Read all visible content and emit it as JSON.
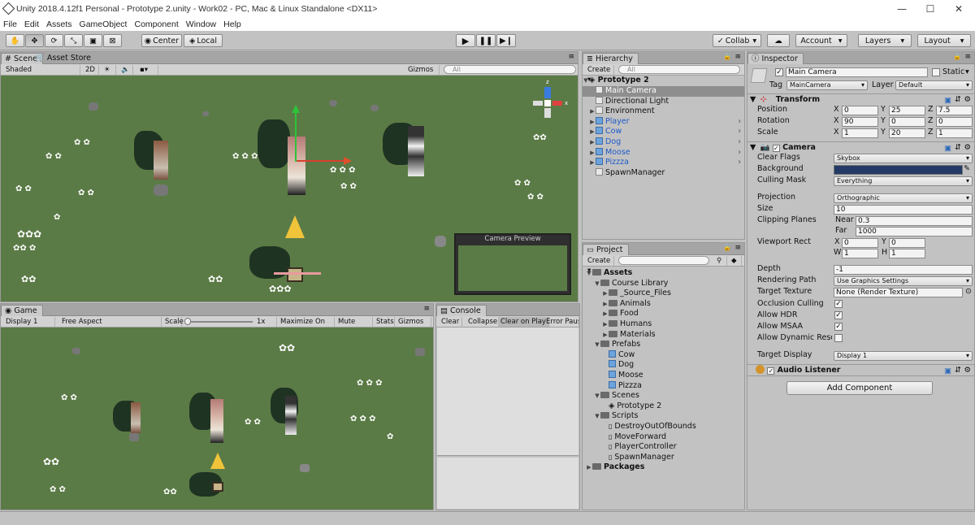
{
  "window": {
    "title": "Unity 2018.4.12f1 Personal - Prototype 2.unity - Work02 - PC, Mac & Linux Standalone <DX11>",
    "min": "—",
    "max": "☐",
    "close": "✕"
  },
  "menu": [
    "File",
    "Edit",
    "Assets",
    "GameObject",
    "Component",
    "Window",
    "Help"
  ],
  "toolbar": {
    "center": "Center",
    "local": "Local",
    "collab": "Collab",
    "account": "Account",
    "layers": "Layers",
    "layout": "Layout"
  },
  "scene": {
    "tab": "Scene",
    "tab2": "Asset Store",
    "shading": "Shaded",
    "mode2d": "2D",
    "gizmos": "Gizmos",
    "search": "All",
    "persp": "z",
    "preview_title": "Camera Preview"
  },
  "game": {
    "tab": "Game",
    "display": "Display 1",
    "aspect": "Free Aspect",
    "scale_label": "Scale",
    "scale_value": "1x",
    "maximize": "Maximize On Play",
    "mute": "Mute Audio",
    "stats": "Stats",
    "gizmos": "Gizmos"
  },
  "console": {
    "tab": "Console",
    "clear": "Clear",
    "collapse": "Collapse",
    "clear_on_play": "Clear on Play",
    "error_pause": "Error Pause"
  },
  "hierarchy": {
    "tab": "Hierarchy",
    "create": "Create",
    "search": "All",
    "scene_name": "Prototype 2",
    "items": [
      {
        "label": "Main Camera",
        "selected": true,
        "prefab": false,
        "expand": false
      },
      {
        "label": "Directional Light",
        "selected": false,
        "prefab": false,
        "expand": false
      },
      {
        "label": "Environment",
        "selected": false,
        "prefab": false,
        "expand": true
      },
      {
        "label": "Player",
        "selected": false,
        "prefab": true,
        "expand": true
      },
      {
        "label": "Cow",
        "selected": false,
        "prefab": true,
        "expand": true
      },
      {
        "label": "Dog",
        "selected": false,
        "prefab": true,
        "expand": true
      },
      {
        "label": "Moose",
        "selected": false,
        "prefab": true,
        "expand": true
      },
      {
        "label": "Pizzza",
        "selected": false,
        "prefab": true,
        "expand": true
      },
      {
        "label": "SpawnManager",
        "selected": false,
        "prefab": false,
        "expand": false
      }
    ]
  },
  "project": {
    "tab": "Project",
    "create": "Create",
    "tree": [
      {
        "label": "Assets",
        "depth": 0,
        "type": "folder",
        "open": true,
        "bold": true
      },
      {
        "label": "Course Library",
        "depth": 1,
        "type": "folder",
        "open": true
      },
      {
        "label": "_Source_Files",
        "depth": 2,
        "type": "folder",
        "open": false
      },
      {
        "label": "Animals",
        "depth": 2,
        "type": "folder",
        "open": false
      },
      {
        "label": "Food",
        "depth": 2,
        "type": "folder",
        "open": false
      },
      {
        "label": "Humans",
        "depth": 2,
        "type": "folder",
        "open": false
      },
      {
        "label": "Materials",
        "depth": 2,
        "type": "folder",
        "open": false
      },
      {
        "label": "Prefabs",
        "depth": 1,
        "type": "folder",
        "open": true
      },
      {
        "label": "Cow",
        "depth": 2,
        "type": "prefab"
      },
      {
        "label": "Dog",
        "depth": 2,
        "type": "prefab"
      },
      {
        "label": "Moose",
        "depth": 2,
        "type": "prefab"
      },
      {
        "label": "Pizzza",
        "depth": 2,
        "type": "prefab"
      },
      {
        "label": "Scenes",
        "depth": 1,
        "type": "folder",
        "open": true
      },
      {
        "label": "Prototype 2",
        "depth": 2,
        "type": "scene"
      },
      {
        "label": "Scripts",
        "depth": 1,
        "type": "folder",
        "open": true
      },
      {
        "label": "DestroyOutOfBounds",
        "depth": 2,
        "type": "script"
      },
      {
        "label": "MoveForward",
        "depth": 2,
        "type": "script"
      },
      {
        "label": "PlayerController",
        "depth": 2,
        "type": "script"
      },
      {
        "label": "SpawnManager",
        "depth": 2,
        "type": "script"
      },
      {
        "label": "Packages",
        "depth": 0,
        "type": "folder",
        "open": false,
        "bold": true
      }
    ]
  },
  "inspector": {
    "tab": "Inspector",
    "object_name": "Main Camera",
    "static": "Static",
    "tag_label": "Tag",
    "tag": "MainCamera",
    "layer_label": "Layer",
    "layer": "Default",
    "transform": {
      "title": "Transform",
      "position": [
        "0",
        "25",
        "7.5"
      ],
      "rotation": [
        "90",
        "0",
        "0"
      ],
      "scale": [
        "1",
        "20",
        "1"
      ],
      "labels": [
        "Position",
        "Rotation",
        "Scale"
      ],
      "x": "X",
      "y": "Y",
      "z": "Z"
    },
    "camera": {
      "title": "Camera",
      "clear_flags": "Skybox",
      "culling_mask": "Everything",
      "projection": "Orthographic",
      "size": "10",
      "near": "0.3",
      "far": "1000",
      "vp": [
        "0",
        "0",
        "1",
        "1"
      ],
      "depth": "-1",
      "rendering_path": "Use Graphics Settings",
      "target_texture": "None (Render Texture)",
      "target_display": "Display 1",
      "labels": {
        "clear_flags": "Clear Flags",
        "background": "Background",
        "culling_mask": "Culling Mask",
        "projection": "Projection",
        "size": "Size",
        "clipping": "Clipping Planes",
        "near": "Near",
        "far": "Far",
        "viewport": "Viewport Rect",
        "x": "X",
        "y": "Y",
        "w": "W",
        "h": "H",
        "depth": "Depth",
        "rendering_path": "Rendering Path",
        "target_texture": "Target Texture",
        "occlusion": "Occlusion Culling",
        "hdr": "Allow HDR",
        "msaa": "Allow MSAA",
        "dyn_res": "Allow Dynamic Resolu",
        "target_display": "Target Display"
      },
      "background_color": "#243a66"
    },
    "audio": {
      "title": "Audio Listener"
    },
    "add_component": "Add Component"
  },
  "colors": {
    "grass": "#5b7b46",
    "selected_row": "#8e8e8e",
    "prefab_blue": "#1c59c9"
  }
}
